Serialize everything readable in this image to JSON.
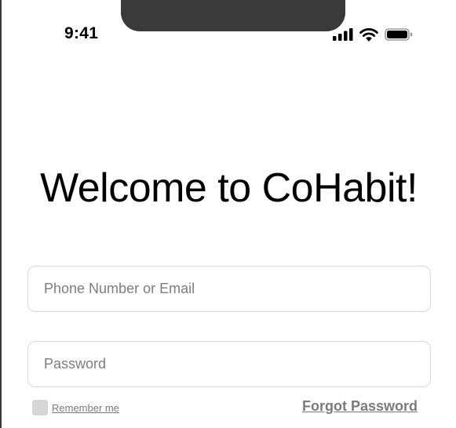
{
  "status_bar": {
    "time": "9:41",
    "icons": [
      "cellular-signal-icon",
      "wifi-icon",
      "battery-icon"
    ]
  },
  "login": {
    "title": "Welcome to CoHabit!",
    "email_placeholder": "Phone Number or Email",
    "email_value": "",
    "password_placeholder": "Password",
    "password_value": "",
    "remember_label": "Remember me",
    "remember_checked": false,
    "forgot_label": "Forgot Password"
  },
  "colors": {
    "background": "#ffffff",
    "text": "#000000",
    "muted_text": "#7b7b7b",
    "field_border": "#d9d9d9",
    "checkbox_fill": "#d6d6d6"
  }
}
